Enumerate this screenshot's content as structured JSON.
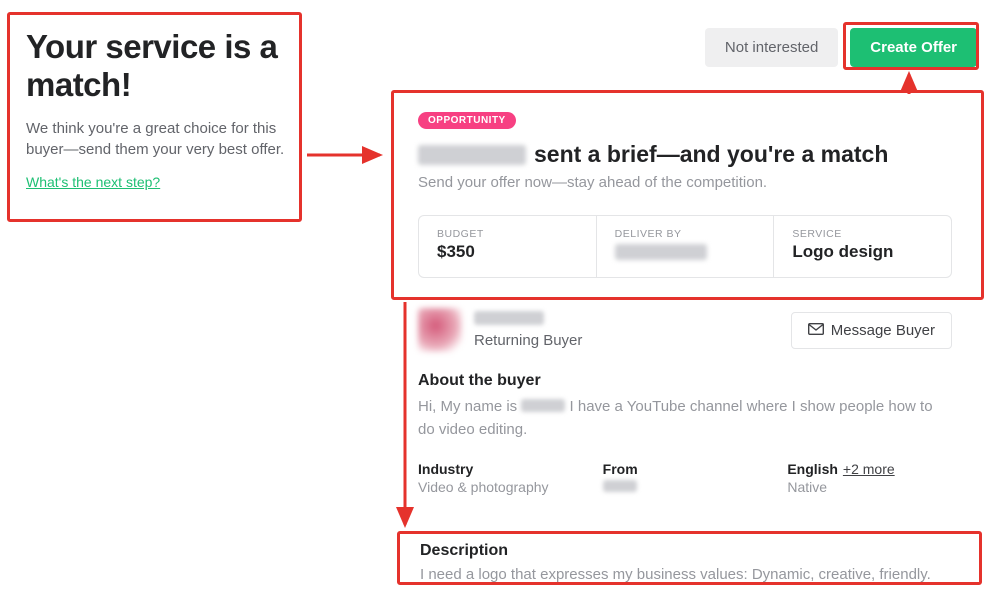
{
  "intro": {
    "title": "Your service is a match!",
    "subtitle": "We think you're a great choice for this buyer—send them your very best offer.",
    "link": "What's the next step?"
  },
  "actions": {
    "not_interested": "Not interested",
    "create_offer": "Create  Offer"
  },
  "opportunity": {
    "pill": "OPPORTUNITY",
    "title_suffix": "sent a brief—and you're a match",
    "subtitle": "Send your offer now—stay ahead of the competition.",
    "budget_label": "BUDGET",
    "budget_value": "$350",
    "deliver_label": "DELIVER BY",
    "service_label": "SERVICE",
    "service_value": "Logo design"
  },
  "buyer": {
    "returning": "Returning Buyer",
    "message_btn": "Message Buyer",
    "about_heading": "About the buyer",
    "about_prefix": "Hi, My name is ",
    "about_suffix": " I have a YouTube channel where I show people how to do video editing.",
    "industry_label": "Industry",
    "industry_value": "Video & photography",
    "from_label": "From",
    "english_label": "English",
    "more_link": "+2 more",
    "english_value": "Native"
  },
  "description": {
    "heading": "Description",
    "text": "I need a logo that expresses my business values: Dynamic, creative, friendly."
  }
}
